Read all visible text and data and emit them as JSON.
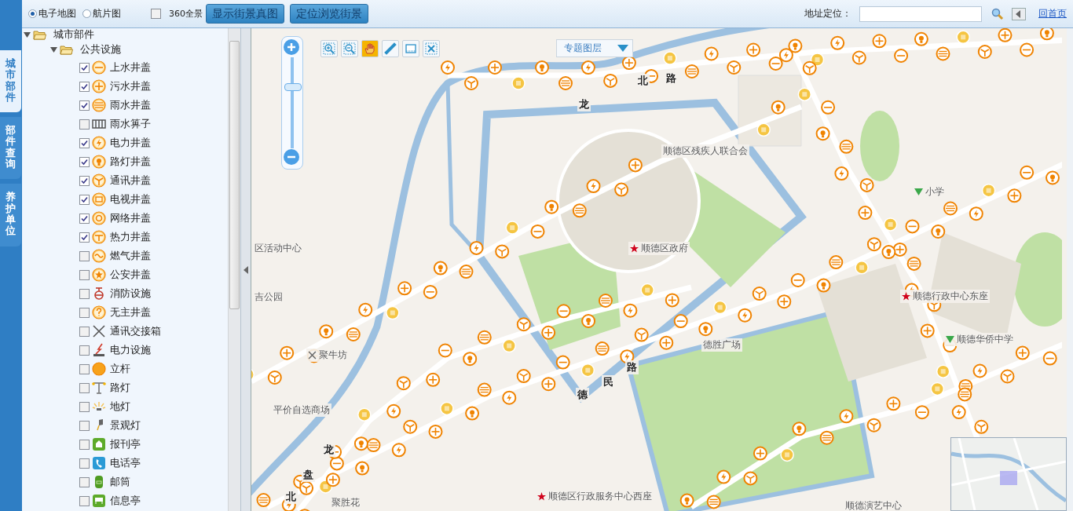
{
  "map_types": [
    {
      "label": "电子地图",
      "selected": true
    },
    {
      "label": "航片图",
      "selected": false
    }
  ],
  "panorama": {
    "label": "360全景",
    "checked": false
  },
  "buttons": [
    "显示街景真图",
    "定位浏览街景"
  ],
  "address": {
    "label": "地址定位："
  },
  "home_link": "回首页",
  "side_tabs": [
    {
      "label": "城市部件",
      "selected": true
    },
    {
      "label": "部件查询",
      "selected": false
    },
    {
      "label": "养护单位",
      "selected": false
    }
  ],
  "tree": {
    "label": "城市部件",
    "expanded": true,
    "children": [
      {
        "label": "公共设施",
        "expanded": true,
        "children": [
          {
            "label": "上水井盖",
            "checked": true,
            "kind": "line"
          },
          {
            "label": "污水井盖",
            "checked": true,
            "kind": "cross"
          },
          {
            "label": "雨水井盖",
            "checked": true,
            "kind": "stripes"
          },
          {
            "label": "雨水箅子",
            "checked": false,
            "kind": "grate"
          },
          {
            "label": "电力井盖",
            "checked": true,
            "kind": "bolt"
          },
          {
            "label": "路灯井盖",
            "checked": true,
            "kind": "bulb"
          },
          {
            "label": "通讯井盖",
            "checked": true,
            "kind": "tri"
          },
          {
            "label": "电视井盖",
            "checked": true,
            "kind": "tv"
          },
          {
            "label": "网络井盖",
            "checked": true,
            "kind": "ring"
          },
          {
            "label": "热力井盖",
            "checked": true,
            "kind": "tee"
          },
          {
            "label": "燃气井盖",
            "checked": false,
            "kind": "wave"
          },
          {
            "label": "公安井盖",
            "checked": false,
            "kind": "star"
          },
          {
            "label": "消防设施",
            "checked": false,
            "kind": "hydrant"
          },
          {
            "label": "无主井盖",
            "checked": false,
            "kind": "question"
          },
          {
            "label": "通讯交接箱",
            "checked": false,
            "kind": "tools"
          },
          {
            "label": "电力设施",
            "checked": false,
            "kind": "power"
          },
          {
            "label": "立杆",
            "checked": false,
            "kind": "dot"
          },
          {
            "label": "路灯",
            "checked": false,
            "kind": "lamp"
          },
          {
            "label": "地灯",
            "checked": false,
            "kind": "groundlight"
          },
          {
            "label": "景观灯",
            "checked": false,
            "kind": "landscape"
          },
          {
            "label": "报刊亭",
            "checked": false,
            "kind": "kiosk"
          },
          {
            "label": "电话亭",
            "checked": false,
            "kind": "phone"
          },
          {
            "label": "邮筒",
            "checked": false,
            "kind": "mailbox"
          },
          {
            "label": "信息亭",
            "checked": false,
            "kind": "info"
          }
        ]
      }
    ]
  },
  "map_tools": [
    {
      "kind": "zoom-in",
      "selected": false
    },
    {
      "kind": "zoom-out",
      "selected": false
    },
    {
      "kind": "pan",
      "selected": true
    },
    {
      "kind": "measure",
      "selected": false
    },
    {
      "kind": "area",
      "selected": false
    },
    {
      "kind": "clear",
      "selected": false
    }
  ],
  "zoom": {
    "level": 0.69
  },
  "layer_menu": "专题图层",
  "map_labels": [
    {
      "text": "龙",
      "kind": "road"
    },
    {
      "text": "北",
      "kind": "road"
    },
    {
      "text": "路",
      "kind": "road"
    },
    {
      "text": "顺德区残疾人联合会",
      "kind": "place"
    },
    {
      "text": "区活动中心",
      "kind": "place"
    },
    {
      "text": "顺德区政府",
      "kind": "poi"
    },
    {
      "text": "吉公园",
      "kind": "park"
    },
    {
      "text": "顺德行政中心东座",
      "kind": "poi"
    },
    {
      "text": "小学",
      "kind": "school"
    },
    {
      "text": "顺德华侨中学",
      "kind": "school"
    },
    {
      "text": "聚牛坊",
      "kind": "food"
    },
    {
      "text": "德胜广场",
      "kind": "place"
    },
    {
      "text": "路",
      "kind": "road"
    },
    {
      "text": "民",
      "kind": "road"
    },
    {
      "text": "德",
      "kind": "road"
    },
    {
      "text": "平价自选商场",
      "kind": "place"
    },
    {
      "text": "龙",
      "kind": "road"
    },
    {
      "text": "盘",
      "kind": "road"
    },
    {
      "text": "北",
      "kind": "road"
    },
    {
      "text": "聚胜花",
      "kind": "place"
    },
    {
      "text": "顺德区行政服务中心西座",
      "kind": "poi"
    },
    {
      "text": "顺德演艺中心",
      "kind": "place"
    }
  ]
}
